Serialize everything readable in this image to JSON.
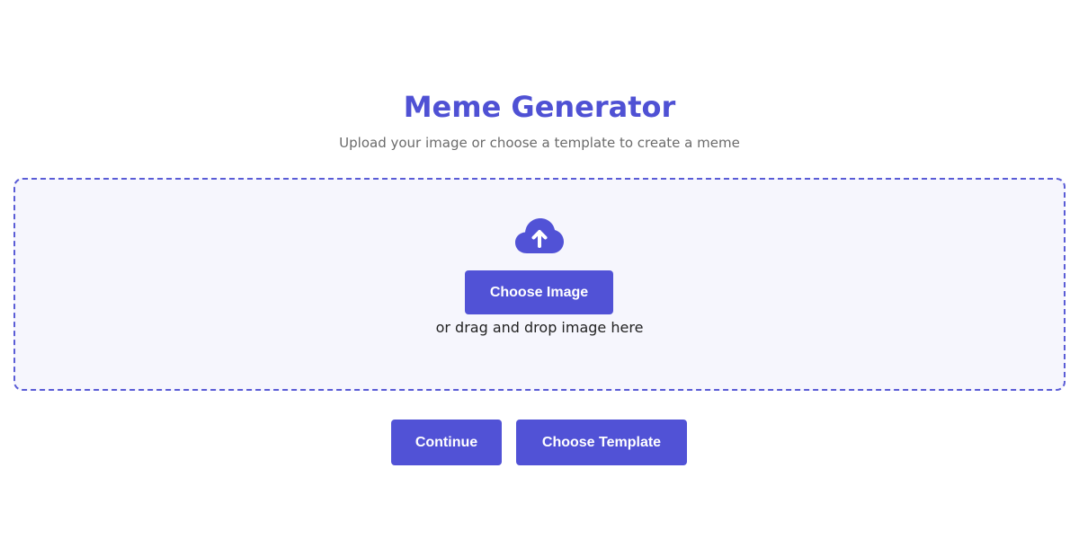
{
  "header": {
    "title": "Meme Generator",
    "subtitle": "Upload your image or choose a template to create a meme"
  },
  "dropzone": {
    "icon": "cloud-upload-icon",
    "choose_image_label": "Choose Image",
    "drag_text": "or drag and drop image here"
  },
  "actions": {
    "continue_label": "Continue",
    "choose_template_label": "Choose Template"
  },
  "colors": {
    "accent": "#5152d6",
    "title": "#4f51d4",
    "dropzone_bg": "#f6f6fd",
    "subtitle": "#6b6b6b"
  }
}
